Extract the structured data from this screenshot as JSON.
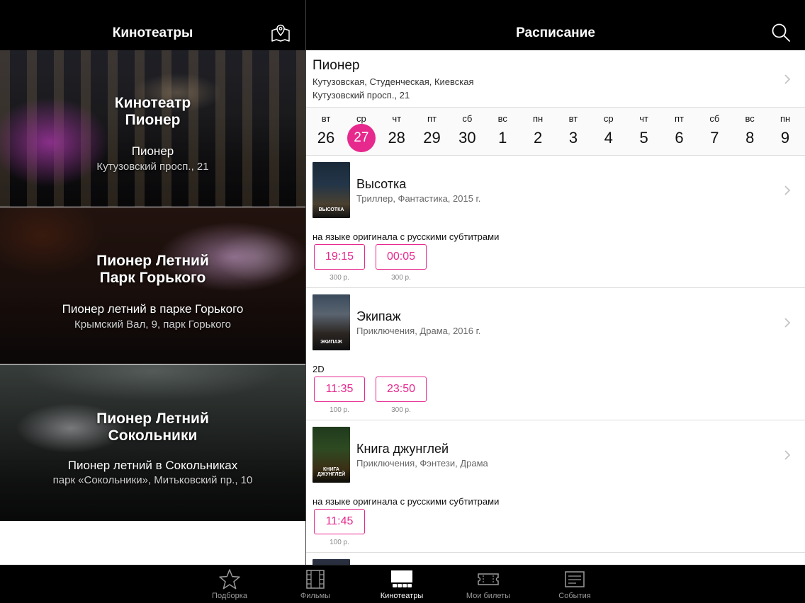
{
  "left_pane": {
    "title": "Кинотеатры",
    "map_icon": "map-pin-icon",
    "cinemas": [
      {
        "name_line1": "Кинотеатр",
        "name_line2": "Пионер",
        "subtitle": "Пионер",
        "address": "Кутузовский просп., 21"
      },
      {
        "name_line1": "Пионер Летний",
        "name_line2": "Парк Горького",
        "subtitle": "Пионер летний в парке Горького",
        "address": "Крымский Вал, 9, парк Горького"
      },
      {
        "name_line1": "Пионер Летний",
        "name_line2": "Сокольники",
        "subtitle": "Пионер летний в Сокольниках",
        "address": "парк «Сокольники», Митьковский пр., 10"
      }
    ]
  },
  "right_pane": {
    "title": "Расписание",
    "search_icon": "search-icon",
    "cinema": {
      "name": "Пионер",
      "metro": "Кутузовская, Студенческая, Киевская",
      "address": "Кутузовский просп., 21"
    },
    "dates": [
      {
        "dow": "вт",
        "day": "26"
      },
      {
        "dow": "ср",
        "day": "27",
        "selected": true
      },
      {
        "dow": "чт",
        "day": "28"
      },
      {
        "dow": "пт",
        "day": "29"
      },
      {
        "dow": "сб",
        "day": "30"
      },
      {
        "dow": "вс",
        "day": "1"
      },
      {
        "dow": "пн",
        "day": "2"
      },
      {
        "dow": "вт",
        "day": "3"
      },
      {
        "dow": "ср",
        "day": "4"
      },
      {
        "dow": "чт",
        "day": "5"
      },
      {
        "dow": "пт",
        "day": "6"
      },
      {
        "dow": "сб",
        "day": "7"
      },
      {
        "dow": "вс",
        "day": "8"
      },
      {
        "dow": "пн",
        "day": "9"
      }
    ],
    "movies": [
      {
        "title": "Высотка",
        "genre": "Триллер, Фантастика, 2015 г.",
        "poster_text": "ВЫСОТКА",
        "format": "на языке оригинала с русскими субтитрами",
        "sessions": [
          {
            "time": "19:15",
            "price": "300 р."
          },
          {
            "time": "00:05",
            "price": "300 р."
          }
        ]
      },
      {
        "title": "Экипаж",
        "genre": "Приключения, Драма, 2016 г.",
        "poster_text": "ЭКИПАЖ",
        "format": "2D",
        "sessions": [
          {
            "time": "11:35",
            "price": "100 р."
          },
          {
            "time": "23:50",
            "price": "300 р."
          }
        ]
      },
      {
        "title": "Книга джунглей",
        "genre": "Приключения, Фэнтези, Драма",
        "poster_text": "КНИГА ДЖУНГЛЕЙ",
        "format": "на языке оригинала с русскими субтитрами",
        "sessions": [
          {
            "time": "11:45",
            "price": "100 р."
          }
        ]
      }
    ]
  },
  "tabbar": {
    "tabs": [
      {
        "label": "Подборка",
        "icon": "star-icon"
      },
      {
        "label": "Фильмы",
        "icon": "film-icon"
      },
      {
        "label": "Кинотеатры",
        "icon": "cinema-seats-icon",
        "active": true
      },
      {
        "label": "Мои билеты",
        "icon": "ticket-icon"
      },
      {
        "label": "События",
        "icon": "events-icon"
      }
    ]
  },
  "colors": {
    "accent": "#e7288d",
    "header_bg": "#000000",
    "tab_inactive": "#9a9a9a"
  }
}
